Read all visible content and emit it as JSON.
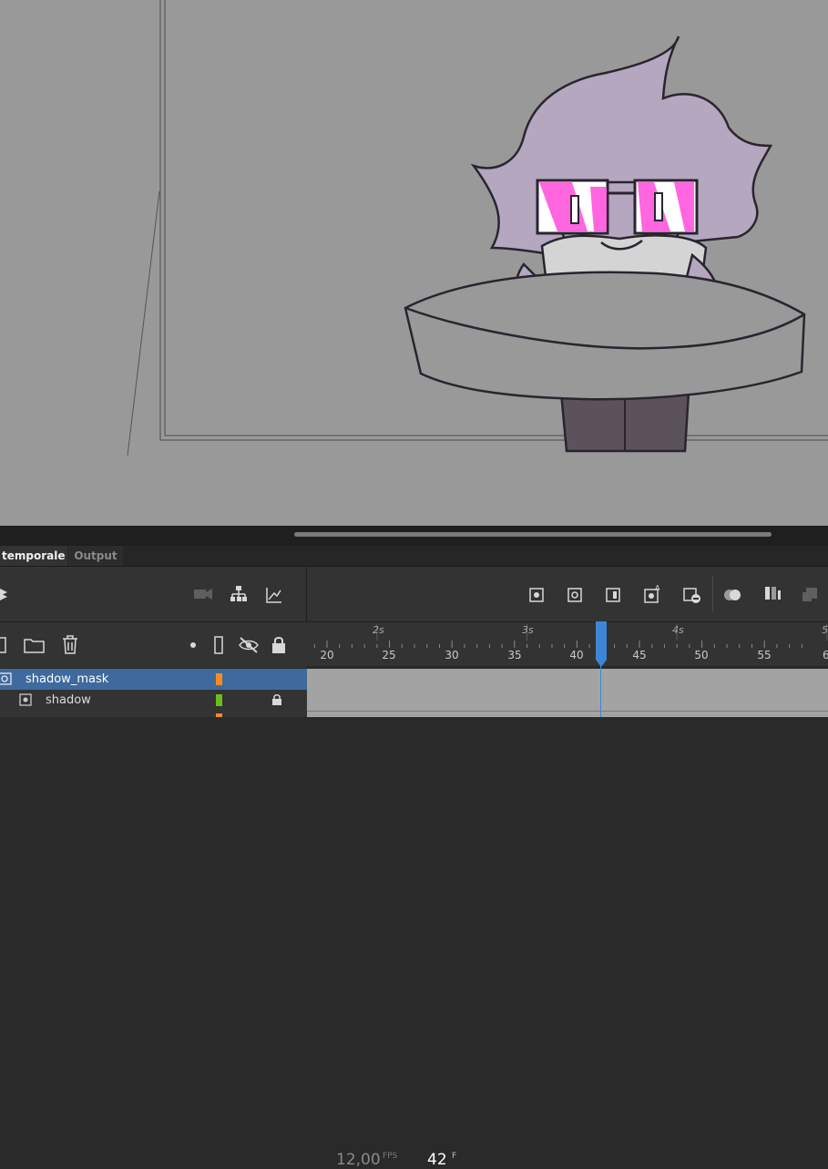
{
  "panel": {
    "tabs": [
      {
        "label": "temporale",
        "active": true
      },
      {
        "label": "Output",
        "active": false
      }
    ]
  },
  "timeline": {
    "fps_value": "12,00",
    "fps_unit": "FPS",
    "current_frame": "42",
    "frame_unit": "F",
    "playhead_frame": 42,
    "ruler": {
      "frame_ticks": [
        "20",
        "25",
        "30",
        "35",
        "40",
        "45",
        "50",
        "55",
        "6"
      ],
      "seconds": [
        "2s",
        "3s",
        "4s",
        "5"
      ]
    },
    "layers": [
      {
        "name": "shadow_mask",
        "selected": true,
        "color": "#ff8a1f",
        "locked": false,
        "icon": "mask-icon"
      },
      {
        "name": "shadow",
        "selected": false,
        "color": "#6cbd1c",
        "locked": true,
        "icon": "masked-layer-icon"
      }
    ]
  },
  "colors": {
    "stage_bg": "#999999",
    "panel_bg": "#333333",
    "playhead": "#3d86d6",
    "selection": "#3e6a9e",
    "hair": "#b4a7bf",
    "glasses": "#ff55dd"
  },
  "icons": [
    "camera-icon",
    "layer-hierarchy-icon",
    "graph-icon",
    "layers-stack-icon",
    "new-layer-icon",
    "folder-icon",
    "trash-icon",
    "dot-icon",
    "outline-icon",
    "visibility-icon",
    "lock-icon",
    "keyframe-icon",
    "blank-keyframe-icon",
    "frame-icon",
    "auto-keyframe-icon",
    "remove-frame-icon",
    "onion-skin-icon",
    "onion-edit-icon",
    "more-icon"
  ]
}
